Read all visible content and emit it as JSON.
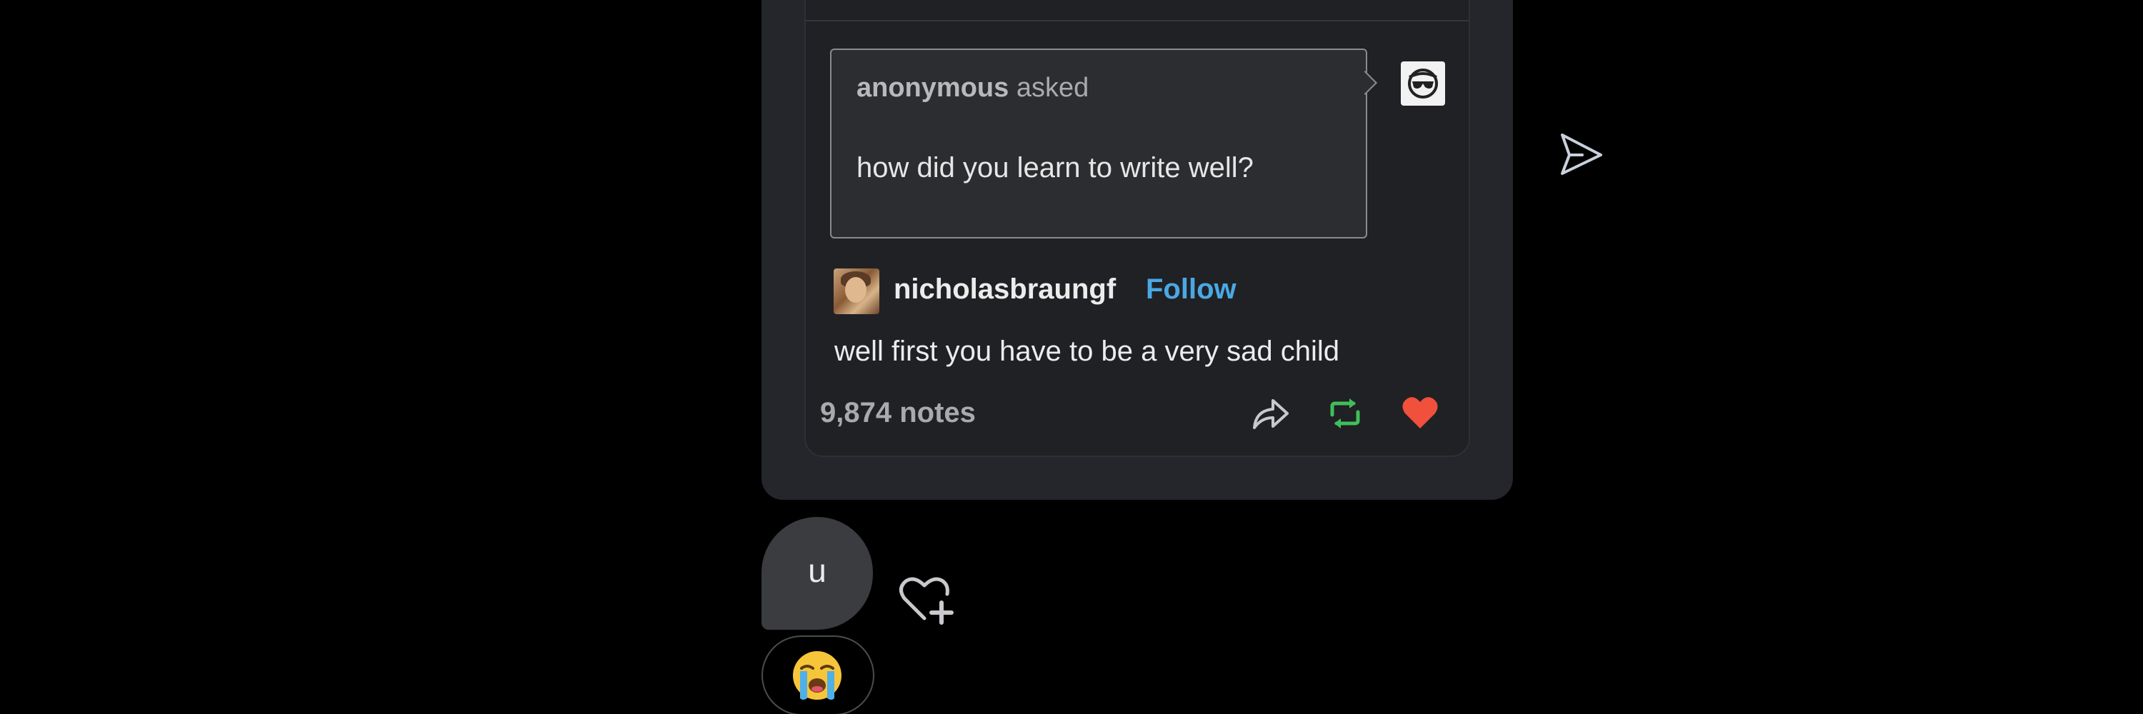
{
  "post": {
    "ask": {
      "asker": "anonymous",
      "asked_label": "asked",
      "question": "how did you learn to write well?"
    },
    "answer": {
      "username": "nicholasbraungf",
      "follow_label": "Follow",
      "text": "well first you have to be a very sad child"
    },
    "notes": "9,874 notes",
    "actions": {
      "share_icon": "share-icon",
      "reblog_icon": "reblog-icon",
      "like_icon": "heart-icon",
      "like_state": "liked",
      "like_color": "#f0503c",
      "reblog_color": "#3fbf5a"
    }
  },
  "chat": {
    "message": "u",
    "reaction_emoji": "loudly-crying-face",
    "add_reaction_icon": "heart-plus-icon",
    "send_icon": "send-icon"
  },
  "colors": {
    "background": "#000000",
    "bubble": "#24262b",
    "card": "#202124",
    "follow": "#4aa8e6"
  }
}
